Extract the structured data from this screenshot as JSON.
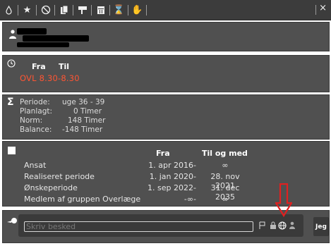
{
  "toolbar": {
    "icons": [
      "drop-icon",
      "star-icon",
      "no-tool-icon",
      "copy-icon",
      "flag-icon",
      "calendar-icon",
      "hourglass-icon",
      "hand-icon"
    ],
    "close_label": "×"
  },
  "time_panel": {
    "col_from": "Fra",
    "col_to": "Til",
    "value": "OVL 8.30-8.30"
  },
  "sum_panel": {
    "rows": [
      {
        "label": "Periode:",
        "value": "uge 36 - 39"
      },
      {
        "label": "Planlagt:",
        "value": "0 Timer"
      },
      {
        "label": "Norm:",
        "value": "148 Timer"
      },
      {
        "label": "Balance:",
        "value": "-148 Timer"
      }
    ]
  },
  "period_panel": {
    "col_from": "Fra",
    "col_to": "Til og med",
    "rows": [
      {
        "label": "Ansat",
        "from": "1. apr 2016",
        "dash": "-",
        "to": "∞"
      },
      {
        "label": "Realiseret periode",
        "from": "1. jan 2020",
        "dash": "-",
        "to": "28. nov 2021"
      },
      {
        "label": "Ønskeperiode",
        "from": "1. sep 2022",
        "dash": "-",
        "to": "31. dec 2035"
      },
      {
        "label": "Medlem af gruppen Overlæge",
        "from": "-∞",
        "dash": "-",
        "to": "∞"
      }
    ]
  },
  "message": {
    "placeholder": "Skriv besked",
    "send_label": "Jeg"
  },
  "colors": {
    "panel_bg": "#505050",
    "toolbar_bg": "#3c3c3c",
    "time_red": "#ff5533",
    "arrow_red": "#e02020"
  }
}
